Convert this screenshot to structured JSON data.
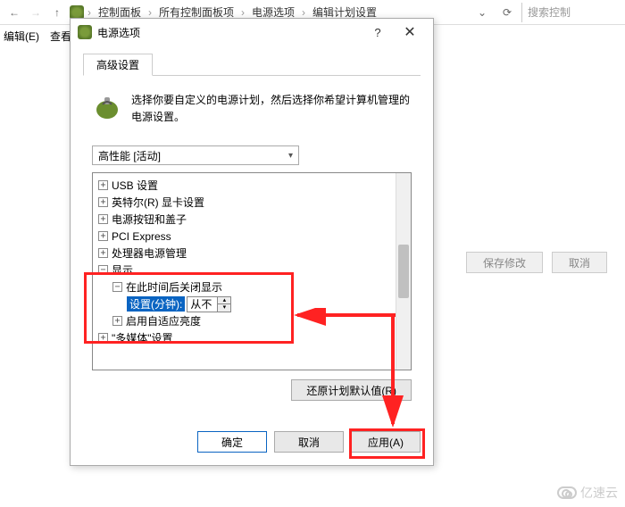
{
  "breadcrumb": {
    "items": [
      "控制面板",
      "所有控制面板项",
      "电源选项",
      "编辑计划设置"
    ],
    "search_placeholder": "搜索控制"
  },
  "menu": {
    "edit": "编辑(E)",
    "view": "查看"
  },
  "side": {
    "save": "保存修改",
    "cancel": "取消"
  },
  "dialog": {
    "title": "电源选项",
    "tab": "高级设置",
    "description": "选择你要自定义的电源计划，然后选择你希望计算机管理的电源设置。",
    "plan_selected": "高性能 [活动]",
    "tree": {
      "usb": "USB 设置",
      "intel": "英特尔(R) 显卡设置",
      "power_button": "电源按钮和盖子",
      "pci": "PCI Express",
      "cpu": "处理器电源管理",
      "display": "显示",
      "display_off": "在此时间后关闭显示",
      "setting_label": "设置(分钟):",
      "setting_value": "从不",
      "adaptive": "启用自适应亮度",
      "multimedia": "\"多媒体\"设置"
    },
    "restore": "还原计划默认值(R)",
    "buttons": {
      "ok": "确定",
      "cancel": "取消",
      "apply": "应用(A)"
    }
  },
  "watermark": "亿速云"
}
